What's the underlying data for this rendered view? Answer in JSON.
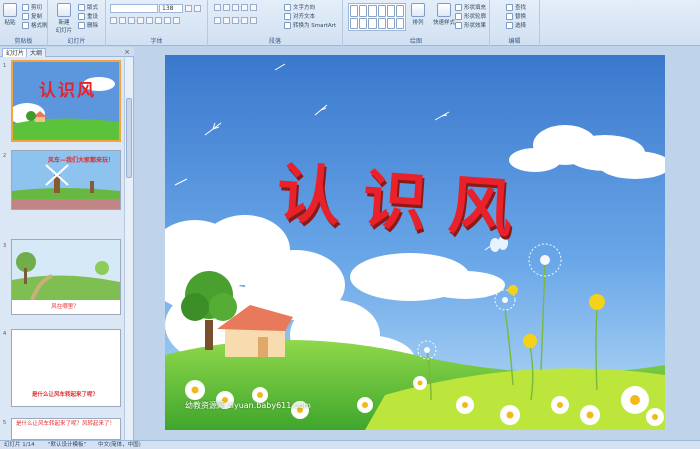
{
  "ribbon": {
    "clipboard": {
      "paste": "粘贴",
      "cut": "剪切",
      "copy": "复制",
      "format_painter": "格式刷",
      "label": "剪贴板"
    },
    "slides": {
      "new_slide": "新建\n幻灯片",
      "layout": "版式",
      "reset": "重设",
      "delete": "删除",
      "label": "幻灯片"
    },
    "font": {
      "size": "138",
      "label": "字体"
    },
    "paragraph": {
      "text_direction": "文字方向",
      "align_text": "对齐文本",
      "smartart": "转换为 SmartArt",
      "label": "段落"
    },
    "drawing": {
      "arrange": "排列",
      "quick_styles": "快速样式",
      "shape_fill": "形状填充",
      "shape_outline": "形状轮廓",
      "shape_effects": "形状效果",
      "label": "绘图"
    },
    "editing": {
      "find": "查找",
      "replace": "替换",
      "select": "选择",
      "label": "编辑"
    }
  },
  "panel": {
    "tab_slides": "幻灯片",
    "tab_outline": "大纲",
    "close": "×"
  },
  "thumbnails": [
    {
      "num": "1",
      "title": "认识风"
    },
    {
      "num": "2",
      "title": "风车—我们大家都来玩！"
    },
    {
      "num": "3",
      "caption": "风在哪里？"
    },
    {
      "num": "4",
      "caption": "是什么让风车转起来了呢？"
    },
    {
      "num": "5",
      "caption": "是什么让风车转起来了呢？风转起来了！"
    }
  ],
  "slide": {
    "title": "认识风",
    "watermark": "幼教资源网 ziyuan.baby611.com"
  },
  "status": {
    "slide_pos": "幻灯片 1/14",
    "theme": "\"默认设计模板\"",
    "lang": "中文(简体，中国)"
  },
  "colors": {
    "title_red": "#e8212a",
    "sky_top": "#3f7fd0",
    "selected_border": "#f3a53b"
  }
}
